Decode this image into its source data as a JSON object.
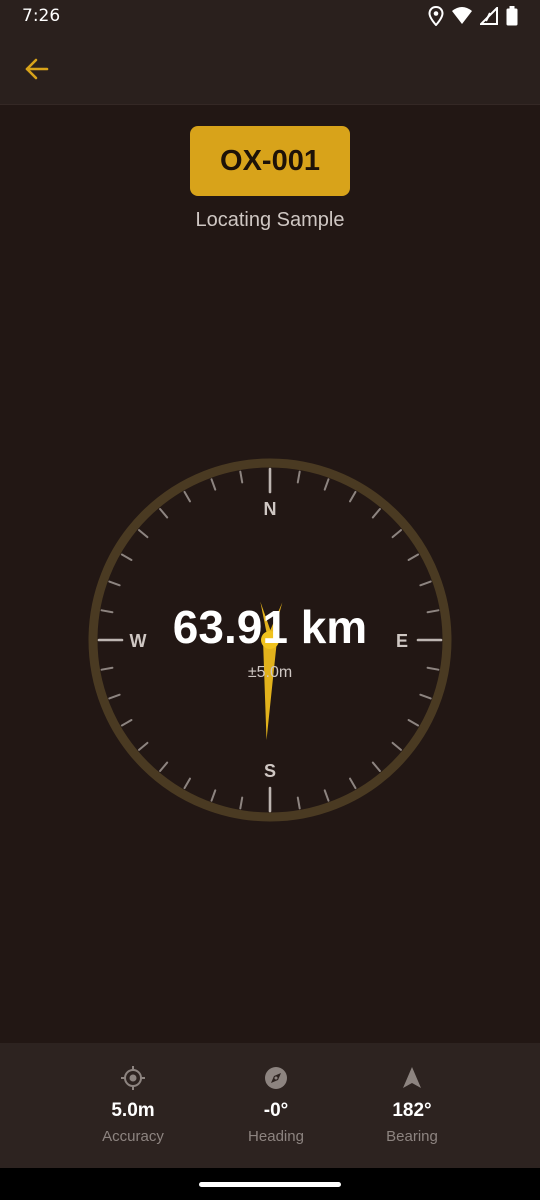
{
  "status_bar": {
    "time": "7:26"
  },
  "header": {
    "back_icon": "arrow-left-icon"
  },
  "sample": {
    "code": "OX-001",
    "status": "Locating Sample"
  },
  "compass": {
    "north": "N",
    "east": "E",
    "south": "S",
    "west": "W",
    "distance": "63.91 km",
    "accuracy": "±5.0m",
    "needle_bearing_deg": 182
  },
  "stats": [
    {
      "icon": "crosshair-icon",
      "value": "5.0m",
      "label": "Accuracy"
    },
    {
      "icon": "compass-icon",
      "value": "-0°",
      "label": "Heading"
    },
    {
      "icon": "navigation-arrow-icon",
      "value": "182°",
      "label": "Bearing"
    }
  ],
  "colors": {
    "background": "#221714",
    "accent": "#d8a31a",
    "ring": "#4a3a22",
    "needle": "#e2b21c"
  }
}
